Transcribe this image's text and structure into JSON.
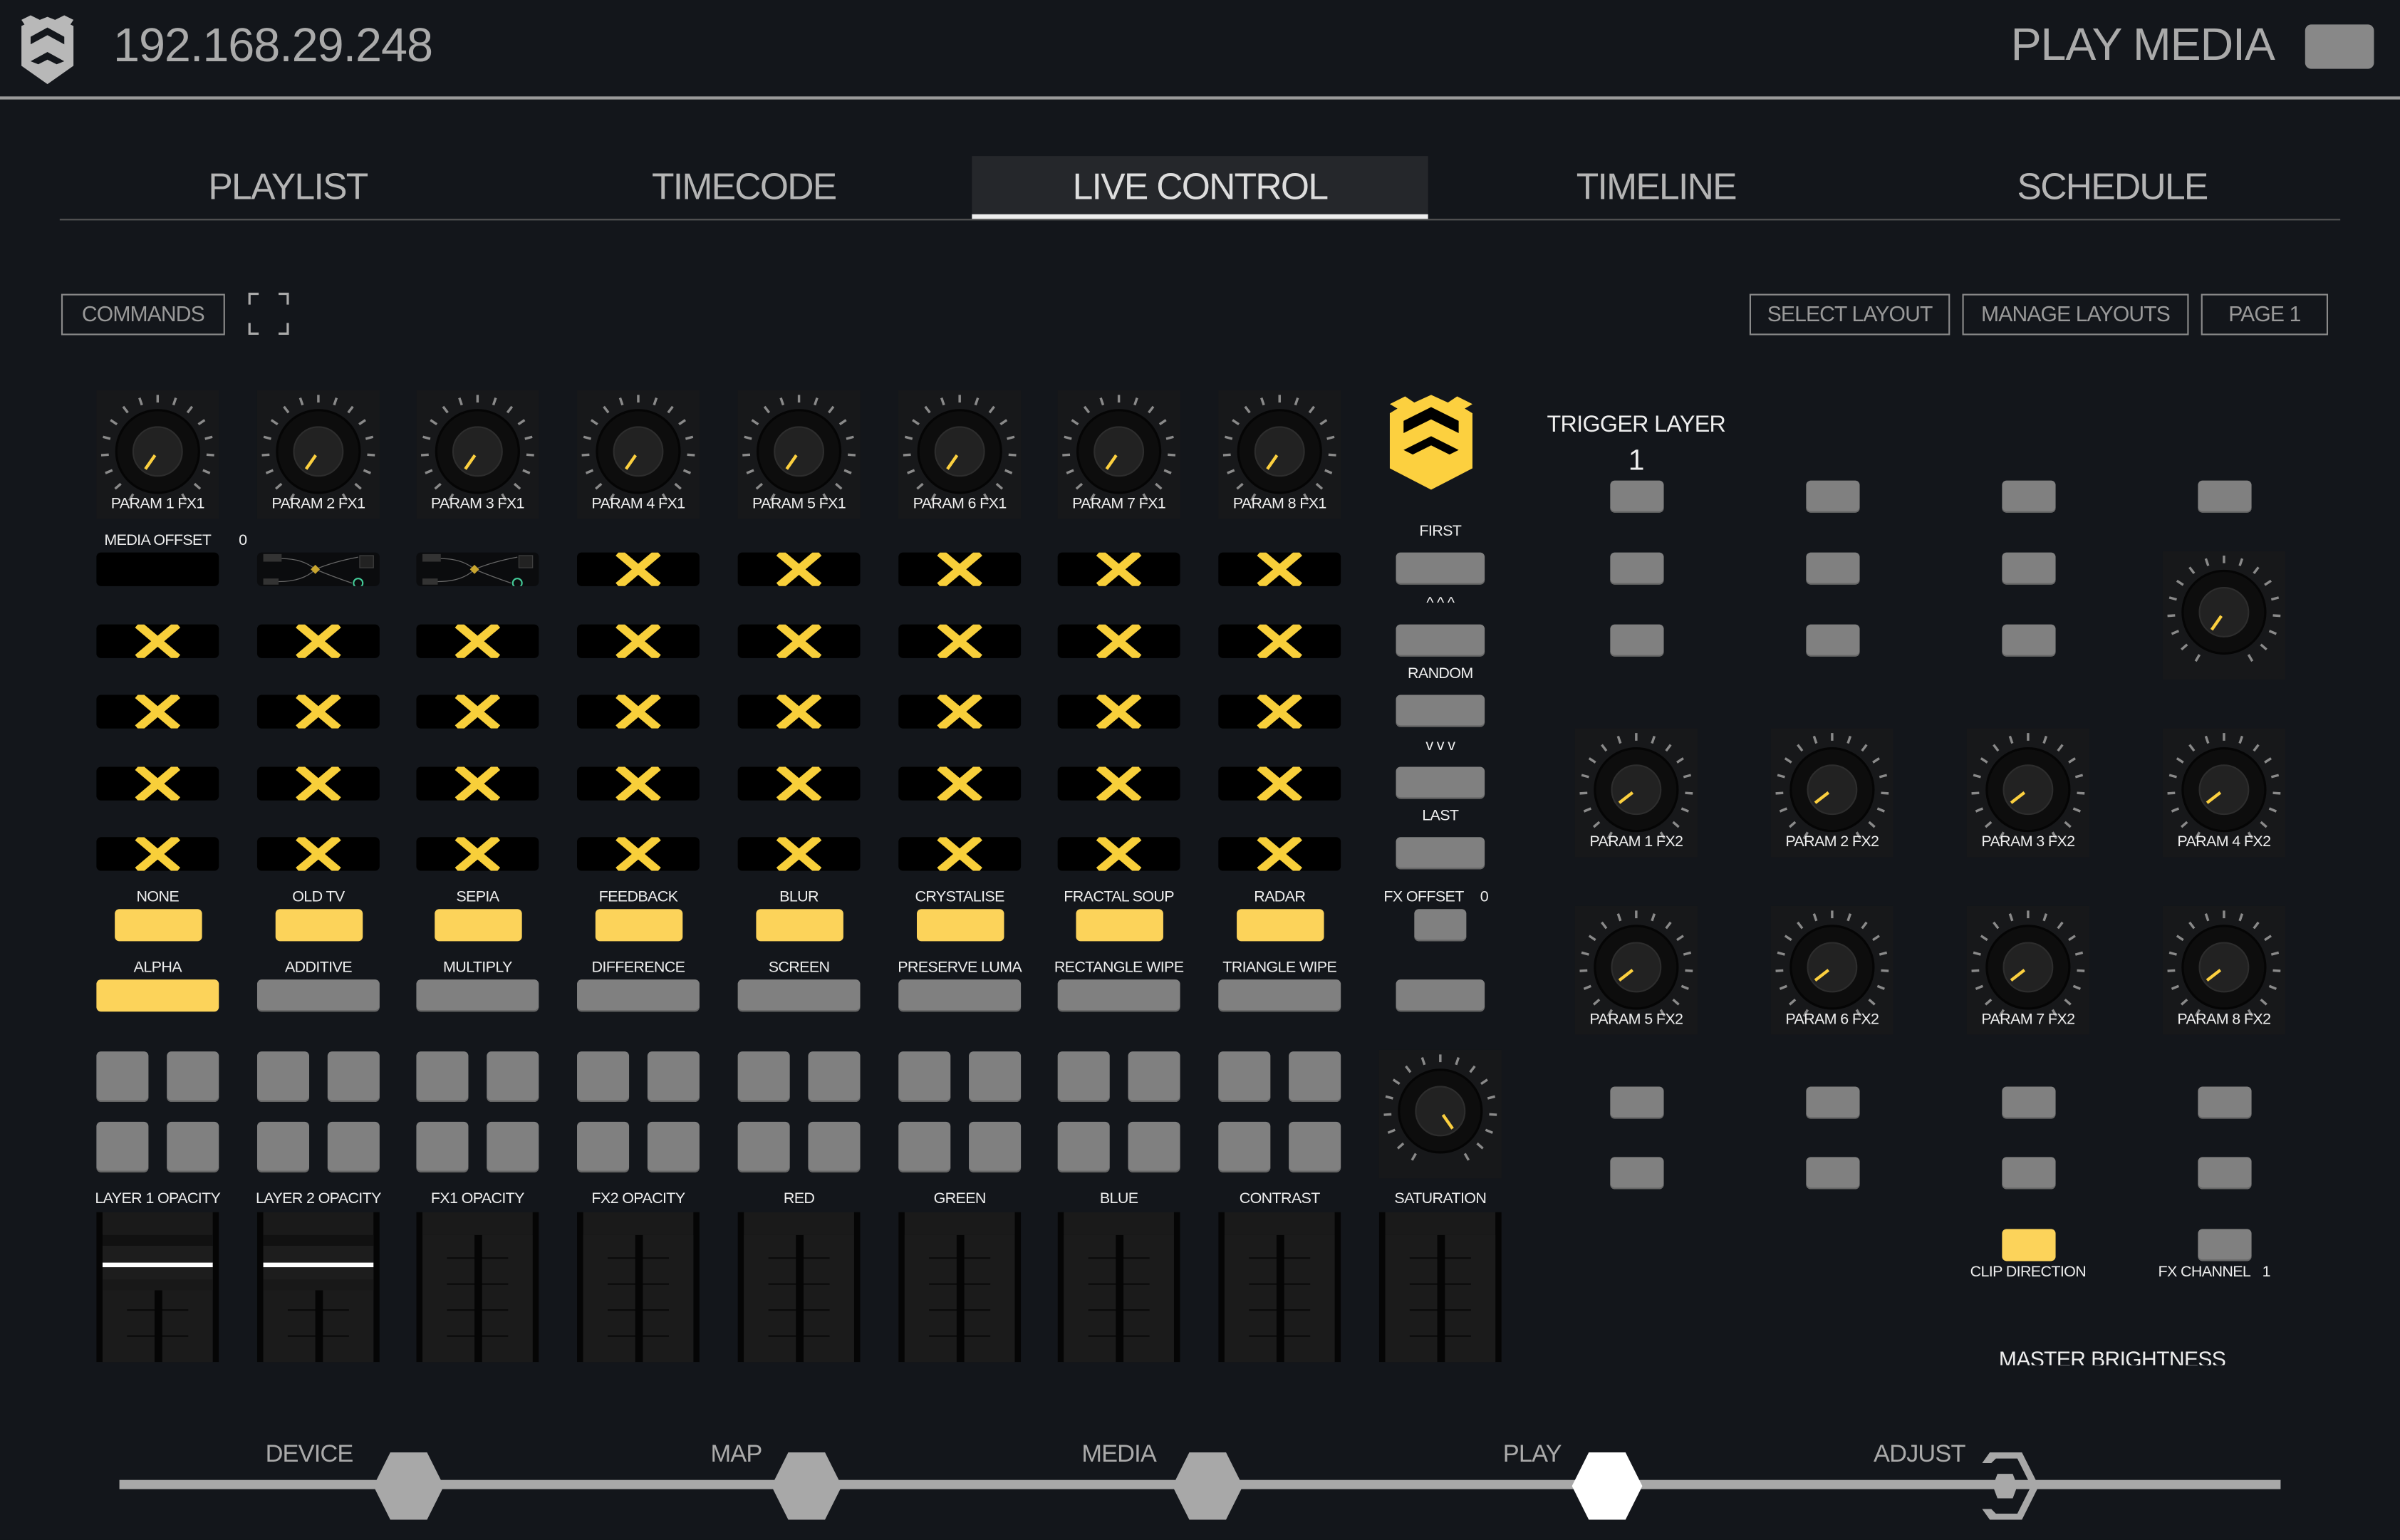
{
  "colors": {
    "accent": "#fcd35a",
    "button": "#808080",
    "background": "#13161b"
  },
  "header": {
    "ip": "192.168.29.248",
    "mode_label": "PLAY MEDIA"
  },
  "tabs": [
    {
      "label": "PLAYLIST",
      "active": false
    },
    {
      "label": "TIMECODE",
      "active": false
    },
    {
      "label": "LIVE CONTROL",
      "active": true
    },
    {
      "label": "TIMELINE",
      "active": false
    },
    {
      "label": "SCHEDULE",
      "active": false
    }
  ],
  "toolbar": {
    "commands": "COMMANDS",
    "select_layout": "SELECT LAYOUT",
    "manage_layouts": "MANAGE LAYOUTS",
    "page": "PAGE 1"
  },
  "fx1_knobs": [
    {
      "label": "PARAM 1 FX1",
      "value": 0
    },
    {
      "label": "PARAM 2 FX1",
      "value": 0
    },
    {
      "label": "PARAM 3 FX1",
      "value": 0
    },
    {
      "label": "PARAM 4 FX1",
      "value": 0
    },
    {
      "label": "PARAM 5 FX1",
      "value": 0
    },
    {
      "label": "PARAM 6 FX1",
      "value": 0
    },
    {
      "label": "PARAM 7 FX1",
      "value": 0
    },
    {
      "label": "PARAM 8 FX1",
      "value": 0
    }
  ],
  "media_offset": {
    "label": "MEDIA OFFSET",
    "value": "0"
  },
  "clip_grid": [
    [
      "empty",
      "thumbnail",
      "thumbnail",
      "x",
      "x",
      "x",
      "x",
      "x"
    ],
    [
      "x",
      "x",
      "x",
      "x",
      "x",
      "x",
      "x",
      "x"
    ],
    [
      "x",
      "x",
      "x",
      "x",
      "x",
      "x",
      "x",
      "x"
    ],
    [
      "x",
      "x",
      "x",
      "x",
      "x",
      "x",
      "x",
      "x"
    ],
    [
      "x",
      "x",
      "x",
      "x",
      "x",
      "x",
      "x",
      "x"
    ]
  ],
  "effects": [
    {
      "label": "NONE",
      "active": true
    },
    {
      "label": "OLD TV",
      "active": true
    },
    {
      "label": "SEPIA",
      "active": true
    },
    {
      "label": "FEEDBACK",
      "active": true
    },
    {
      "label": "BLUR",
      "active": true
    },
    {
      "label": "CRYSTALISE",
      "active": true
    },
    {
      "label": "FRACTAL SOUP",
      "active": true
    },
    {
      "label": "RADAR",
      "active": true
    }
  ],
  "blend_modes": [
    {
      "label": "ALPHA",
      "active": true
    },
    {
      "label": "ADDITIVE",
      "active": false
    },
    {
      "label": "MULTIPLY",
      "active": false
    },
    {
      "label": "DIFFERENCE",
      "active": false
    },
    {
      "label": "SCREEN",
      "active": false
    },
    {
      "label": "PRESERVE LUMA",
      "active": false
    },
    {
      "label": "RECTANGLE WIPE",
      "active": false
    },
    {
      "label": "TRIANGLE WIPE",
      "active": false
    }
  ],
  "faders": [
    {
      "label": "LAYER 1 OPACITY",
      "value": 1
    },
    {
      "label": "LAYER 2 OPACITY",
      "value": 1
    },
    {
      "label": "FX1 OPACITY",
      "value": 0
    },
    {
      "label": "FX2 OPACITY",
      "value": 0
    },
    {
      "label": "RED",
      "value": 0
    },
    {
      "label": "GREEN",
      "value": 0
    },
    {
      "label": "BLUE",
      "value": 0
    },
    {
      "label": "CONTRAST",
      "value": 0
    },
    {
      "label": "SATURATION",
      "value": 0
    }
  ],
  "playlist_nav": {
    "first": "FIRST",
    "up": "^ ^ ^",
    "random": "RANDOM",
    "down": "v v v",
    "last": "LAST",
    "fx_offset": {
      "label": "FX OFFSET",
      "value": "0"
    }
  },
  "saturation_knob": {
    "value": 1
  },
  "trigger_layer": {
    "label": "TRIGGER LAYER",
    "value": "1"
  },
  "right_knob": {
    "value": 0
  },
  "fx2_knobs": [
    {
      "label": "PARAM 1 FX2",
      "value": 0.06
    },
    {
      "label": "PARAM 2 FX2",
      "value": 0.06
    },
    {
      "label": "PARAM 3 FX2",
      "value": 0.06
    },
    {
      "label": "PARAM 4 FX2",
      "value": 0.06
    },
    {
      "label": "PARAM 5 FX2",
      "value": 0.06
    },
    {
      "label": "PARAM 6 FX2",
      "value": 0.06
    },
    {
      "label": "PARAM 7 FX2",
      "value": 0.06
    },
    {
      "label": "PARAM 8 FX2",
      "value": 0.06
    }
  ],
  "clip_direction": {
    "label": "CLIP DIRECTION",
    "active": true
  },
  "fx_channel": {
    "label": "FX CHANNEL",
    "value": "1"
  },
  "master_brightness": "MASTER BRIGHTNESS",
  "bottom_nav": [
    {
      "label": "DEVICE",
      "active": false
    },
    {
      "label": "MAP",
      "active": false
    },
    {
      "label": "MEDIA",
      "active": false
    },
    {
      "label": "PLAY",
      "active": true
    },
    {
      "label": "ADJUST",
      "active": false
    }
  ]
}
